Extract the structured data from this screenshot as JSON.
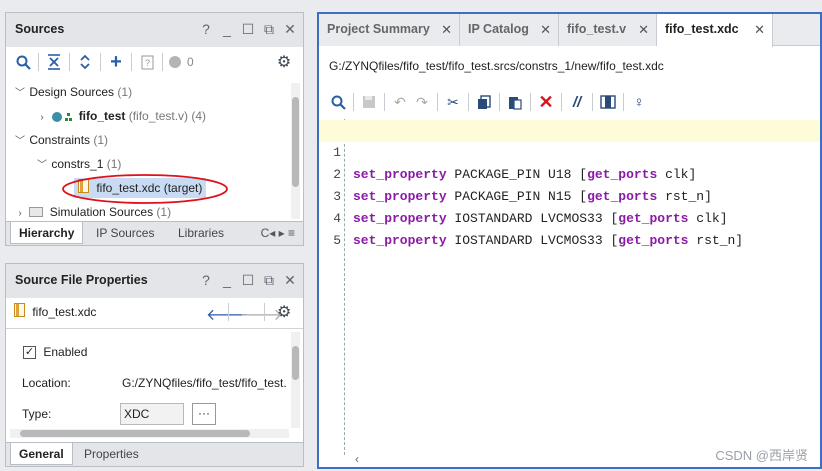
{
  "sources": {
    "title": "Sources",
    "toolbar": {
      "count": "0"
    },
    "tree": {
      "design_sources": "Design Sources",
      "design_sources_count": "(1)",
      "fifo_test": "fifo_test",
      "fifo_test_detail": "(fifo_test.v) (4)",
      "constraints": "Constraints",
      "constraints_count": "(1)",
      "constrs_1": "constrs_1",
      "constrs_1_count": "(1)",
      "xdc_file": "fifo_test.xdc (target)",
      "simulation_sources": "Simulation Sources",
      "simulation_sources_count": "(1)"
    },
    "tabs": [
      "Hierarchy",
      "IP Sources",
      "Libraries"
    ]
  },
  "properties": {
    "title": "Source File Properties",
    "file_name": "fifo_test.xdc",
    "enabled_label": "Enabled",
    "location_label": "Location:",
    "location_value": "G:/ZYNQfiles/fifo_test/fifo_test.",
    "type_label": "Type:",
    "type_value": "XDC",
    "more_button": "···",
    "tabs": [
      "General",
      "Properties"
    ]
  },
  "editor": {
    "tabs": [
      {
        "label": "Project Summary"
      },
      {
        "label": "IP Catalog"
      },
      {
        "label": "fifo_test.v"
      },
      {
        "label": "fifo_test.xdc"
      }
    ],
    "path": "G:/ZYNQfiles/fifo_test/fifo_test.srcs/constrs_1/new/fifo_test.xdc",
    "lines": [
      {
        "num": "1",
        "cmd": "set_property",
        "mid": " PACKAGE_PIN U18 ",
        "open": "[",
        "fn": "get_ports",
        "arg": " clk",
        "close": "]"
      },
      {
        "num": "2",
        "cmd": "set_property",
        "mid": " PACKAGE_PIN N15 ",
        "open": "[",
        "fn": "get_ports",
        "arg": " rst_n",
        "close": "]"
      },
      {
        "num": "3",
        "cmd": "set_property",
        "mid": " IOSTANDARD LVCMOS33 ",
        "open": "[",
        "fn": "get_ports",
        "arg": " clk",
        "close": "]"
      },
      {
        "num": "4",
        "cmd": "set_property",
        "mid": " IOSTANDARD LVCMOS33 ",
        "open": "[",
        "fn": "get_ports",
        "arg": " rst_n",
        "close": "]"
      },
      {
        "num": "5",
        "cmd": "",
        "mid": "",
        "open": "",
        "fn": "",
        "arg": "",
        "close": ""
      }
    ]
  },
  "watermark": "CSDN @西岸贤",
  "colors": {
    "accent": "#2a5ea8",
    "keyword": "#8b1aa6",
    "annotation": "#e0101a",
    "highlight_line": "#fdfbd8"
  }
}
